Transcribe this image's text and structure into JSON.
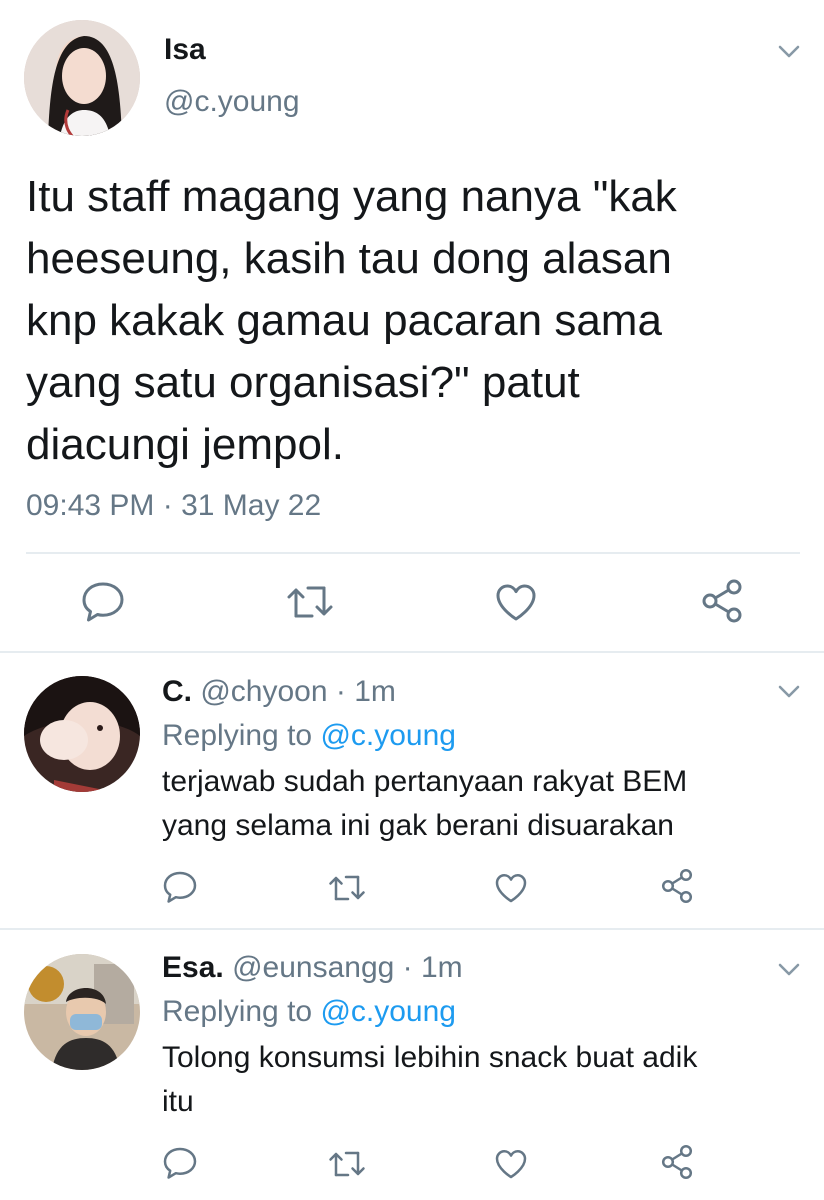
{
  "main_tweet": {
    "name": "Isa",
    "handle": "@c.young",
    "text_lines": [
      "Itu staff magang yang nanya \"kak",
      "heeseung, kasih tau dong alasan",
      "knp kakak gamau pacaran sama",
      "yang satu organisasi?\" patut",
      "diacungi jempol."
    ],
    "timestamp": "09:43 PM · 31 May 22"
  },
  "replies": [
    {
      "name": "C.",
      "handle": "@chyoon",
      "time": "· 1m",
      "replying_prefix": "Replying to",
      "replying_handle": "@c.young",
      "text_lines": [
        "terjawab sudah pertanyaan rakyat BEM",
        "yang selama ini gak berani disuarakan"
      ]
    },
    {
      "name": "Esa.",
      "handle": "@eunsangg",
      "time": "· 1m",
      "replying_prefix": "Replying to",
      "replying_handle": "@c.young",
      "text_lines": [
        "Tolong konsumsi lebihin snack buat adik",
        "itu"
      ]
    }
  ],
  "icons": {
    "reply": "speech-bubble-icon",
    "retweet": "retweet-icon",
    "like": "heart-icon",
    "share": "share-icon",
    "menu": "chevron-down-icon"
  },
  "colors": {
    "text": "#14171a",
    "muted": "#657786",
    "link": "#1d9bf0",
    "divider": "#e6ecf0"
  }
}
